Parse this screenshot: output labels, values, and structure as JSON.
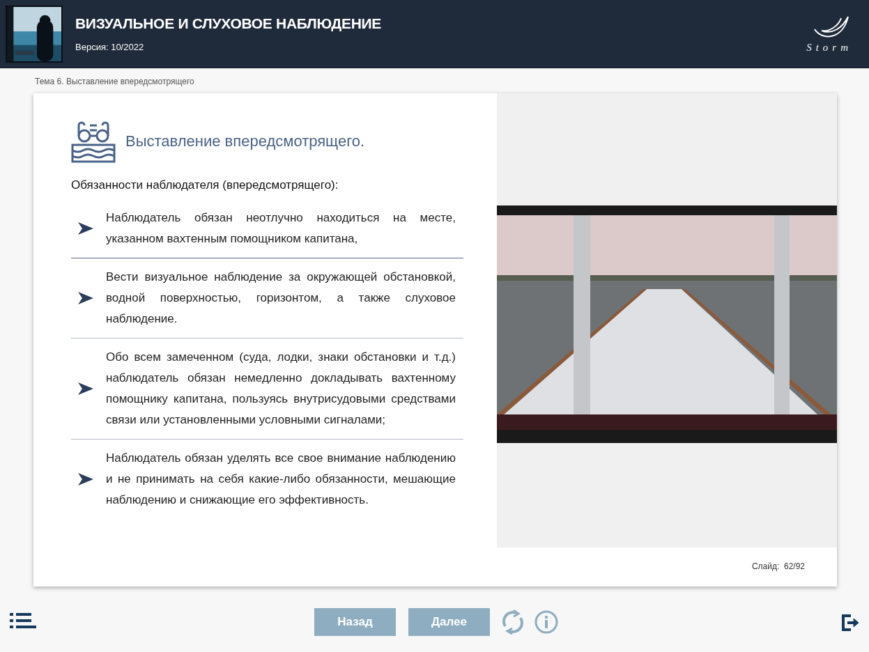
{
  "header": {
    "title": "ВИЗУАЛЬНОЕ И СЛУХОВОЕ НАБЛЮДЕНИЕ",
    "version": "Версия: 10/2022",
    "logo_text": "Storm"
  },
  "breadcrumb": "Тема 6. Выставление впередсмотрящего",
  "slide": {
    "heading": "Выставление впередсмотрящего.",
    "subheading": "Обязанности наблюдателя (впередсмотрящего):",
    "items": [
      {
        "text": "Наблюдатель обязан неотлучно находиться на месте, указанном вахтенным помощником капитана,"
      },
      {
        "text": "Вести визуальное наблюдение за окружающей обстановкой, водной поверхностью, горизонтом, а также слуховое наблюдение."
      },
      {
        "text": "Обо всем замеченном (суда, лодки, знаки обстановки и т.д.) наблюдатель обязан немедленно докладывать вахтенному помощнику капитана, пользуясь внутрисудовыми средствами связи или установленными условными сигналами;"
      },
      {
        "text": "Наблюдатель обязан уделять все свое внимание наблюдению и не принимать на себя какие-либо обязанности, мешающие наблюдению и снижающие его эффективность."
      }
    ],
    "counter": "Слайд:  62/92"
  },
  "nav": {
    "buttons": [
      {
        "label": "Назад"
      },
      {
        "label": "Далее"
      }
    ]
  }
}
